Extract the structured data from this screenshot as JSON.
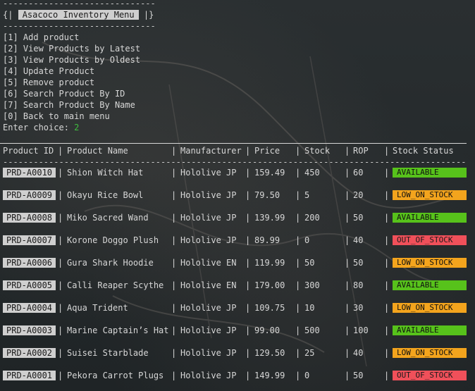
{
  "menu": {
    "dash_rule": "------------------------------",
    "title_left": "{|",
    "title": "Asacoco Inventory Menu",
    "title_right": "|}",
    "options": [
      "[1] Add product",
      "[2] View Products by Latest",
      "[3] View Products by Oldest",
      "[4] Update Product",
      "[5] Remove product",
      "[6] Search Product By ID",
      "[7] Search Product By Name",
      "[0] Back to main menu"
    ],
    "prompt": "Enter choice:",
    "choice": "2"
  },
  "table": {
    "headers": {
      "id": "Product ID",
      "name": "Product Name",
      "manufacturer": "Manufacturer",
      "price": "Price",
      "stock": "Stock",
      "rop": "ROP",
      "status": "Stock Status"
    },
    "header_rule": "---------------------------------------------------------------------------------------------------",
    "separator": "|",
    "rows": [
      {
        "id": "PRD-A0010",
        "name": "Shion Witch Hat",
        "manufacturer": "Hololive JP",
        "price": "159.49",
        "stock": "450",
        "rop": "60",
        "status": "AVAILABLE"
      },
      {
        "id": "PRD-A0009",
        "name": "Okayu Rice Bowl",
        "manufacturer": "Hololive JP",
        "price": "79.50",
        "stock": "5",
        "rop": "20",
        "status": "LOW_ON_STOCK"
      },
      {
        "id": "PRD-A0008",
        "name": "Miko Sacred Wand",
        "manufacturer": "Hololive JP",
        "price": "139.99",
        "stock": "200",
        "rop": "50",
        "status": "AVAILABLE"
      },
      {
        "id": "PRD-A0007",
        "name": "Korone Doggo Plush",
        "manufacturer": "Hololive JP",
        "price": "89.99",
        "stock": "0",
        "rop": "40",
        "status": "OUT_OF_STOCK"
      },
      {
        "id": "PRD-A0006",
        "name": "Gura Shark Hoodie",
        "manufacturer": "Hololive EN",
        "price": "119.99",
        "stock": "50",
        "rop": "50",
        "status": "LOW_ON_STOCK"
      },
      {
        "id": "PRD-A0005",
        "name": "Calli Reaper Scythe",
        "manufacturer": "Hololive EN",
        "price": "179.00",
        "stock": "300",
        "rop": "80",
        "status": "AVAILABLE"
      },
      {
        "id": "PRD-A0004",
        "name": "Aqua Trident",
        "manufacturer": "Hololive JP",
        "price": "109.75",
        "stock": "10",
        "rop": "30",
        "status": "LOW_ON_STOCK"
      },
      {
        "id": "PRD-A0003",
        "name": "Marine Captain’s Hat",
        "manufacturer": "Hololive JP",
        "price": "99.00",
        "stock": "500",
        "rop": "100",
        "status": "AVAILABLE"
      },
      {
        "id": "PRD-A0002",
        "name": "Suisei Starblade",
        "manufacturer": "Hololive JP",
        "price": "129.50",
        "stock": "25",
        "rop": "40",
        "status": "LOW_ON_STOCK"
      },
      {
        "id": "PRD-A0001",
        "name": "Pekora Carrot Plugs",
        "manufacturer": "Hololive JP",
        "price": "149.99",
        "stock": "0",
        "rop": "50",
        "status": "OUT_OF_STOCK"
      }
    ]
  },
  "colors": {
    "available": "#57c21b",
    "low_on_stock": "#f3a41d",
    "out_of_stock": "#f0505a",
    "choice": "#3fbf3f"
  }
}
